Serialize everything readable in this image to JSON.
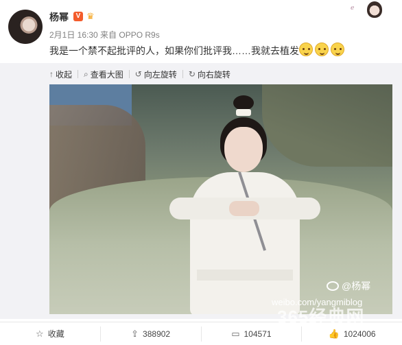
{
  "post": {
    "username": "杨幂",
    "verified_mark": "V",
    "vip_mark": "♛",
    "meta": "2月1日 16:30 来自 OPPO R9s",
    "text": "我是一个禁不起批评的人，如果你们批评我……我就去植发",
    "emoji_count": 3
  },
  "corner_card": {
    "text": "ℯ"
  },
  "media_toolbar": {
    "collapse": "收起",
    "view_large": "查看大图",
    "rotate_left": "向左旋转",
    "rotate_right": "向右旋转",
    "icons": {
      "collapse": "↑",
      "view_large": "⌕",
      "rotate_left": "↺",
      "rotate_right": "↻"
    }
  },
  "photo": {
    "watermark_handle": "@杨幂",
    "watermark_url": "weibo.com/yangmiblog"
  },
  "actions": {
    "favorite": "收藏",
    "repost": "388902",
    "comment": "104571",
    "like": "1024006",
    "icons": {
      "favorite": "☆",
      "repost": "⇪",
      "comment": "▭",
      "like": "👍"
    }
  },
  "site_watermark": "365经典网",
  "colors": {
    "verified": "#f35c2c",
    "meta_text": "#808080",
    "media_bg": "#f2f2f5"
  }
}
